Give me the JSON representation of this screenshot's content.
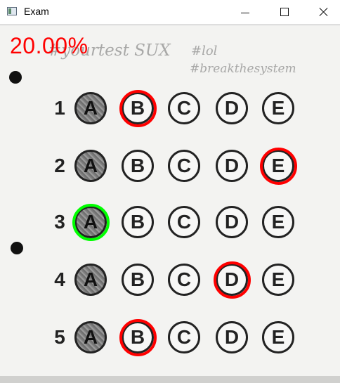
{
  "window": {
    "title": "Exam",
    "controls": {
      "minimize": "minimize-icon",
      "maximize": "maximize-icon",
      "close": "close-icon"
    }
  },
  "overlay": {
    "score": "20.00%",
    "colors": {
      "wrong": "#ff0000",
      "correct": "#00ff00",
      "ink": "#222222"
    }
  },
  "handwriting": {
    "line1": "#yourtest SUX",
    "line2": "#lol",
    "line3": "#breakthesystem"
  },
  "questions": [
    {
      "number": "1",
      "choices": [
        "A",
        "B",
        "C",
        "D",
        "E"
      ],
      "filled": "A",
      "marked": "B",
      "mark_color": "red"
    },
    {
      "number": "2",
      "choices": [
        "A",
        "B",
        "C",
        "D",
        "E"
      ],
      "filled": "A",
      "marked": "E",
      "mark_color": "red"
    },
    {
      "number": "3",
      "choices": [
        "A",
        "B",
        "C",
        "D",
        "E"
      ],
      "filled": "A",
      "marked": "A",
      "mark_color": "green"
    },
    {
      "number": "4",
      "choices": [
        "A",
        "B",
        "C",
        "D",
        "E"
      ],
      "filled": "A",
      "marked": "D",
      "mark_color": "red"
    },
    {
      "number": "5",
      "choices": [
        "A",
        "B",
        "C",
        "D",
        "E"
      ],
      "filled": "A",
      "marked": "B",
      "mark_color": "red"
    }
  ]
}
